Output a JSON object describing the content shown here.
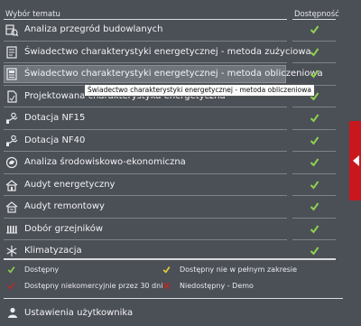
{
  "header": {
    "topic": "Wybór tematu",
    "availability": "Dostępność"
  },
  "rows": [
    {
      "label": "Analiza przegród budowlanych",
      "icon": "wall-analysis-icon"
    },
    {
      "label": "Świadectwo charakterystyki energetycznej - metoda zużyciowa",
      "icon": "certificate-icon"
    },
    {
      "label": "Świadectwo charakterystyki energetycznej - metoda obliczeniowa",
      "icon": "certificate-calc-icon"
    },
    {
      "label": "Projektowana charakterystyka energetyczna",
      "icon": "document-icon"
    },
    {
      "label": "Dotacja NF15",
      "icon": "grant-icon"
    },
    {
      "label": "Dotacja NF40",
      "icon": "grant-icon"
    },
    {
      "label": "Analiza środowiskowo-ekonomiczna",
      "icon": "environment-icon"
    },
    {
      "label": "Audyt energetyczny",
      "icon": "audit-icon"
    },
    {
      "label": "Audyt remontowy",
      "icon": "renovation-audit-icon"
    },
    {
      "label": "Dobór grzejników",
      "icon": "radiator-icon"
    },
    {
      "label": "Klimatyzacja",
      "icon": "snowflake-icon"
    }
  ],
  "tooltip": "Świadectwo charakterystyki energetycznej - metoda obliczeniowa",
  "legend": {
    "available": "Dostępny",
    "partial": "Dostępny nie w pełnym zakresie",
    "noncommercial": "Dostępny niekomercyjnie przez 30 dni",
    "unavailable": "Niedostępny - Demo"
  },
  "settings": "Ustawienia użytkownika",
  "colors": {
    "background": "#4b4f56",
    "check_green": "#8fd14f",
    "check_yellow": "#e6d23c",
    "check_red": "#b62a2a",
    "side_tab": "#c8181d"
  }
}
